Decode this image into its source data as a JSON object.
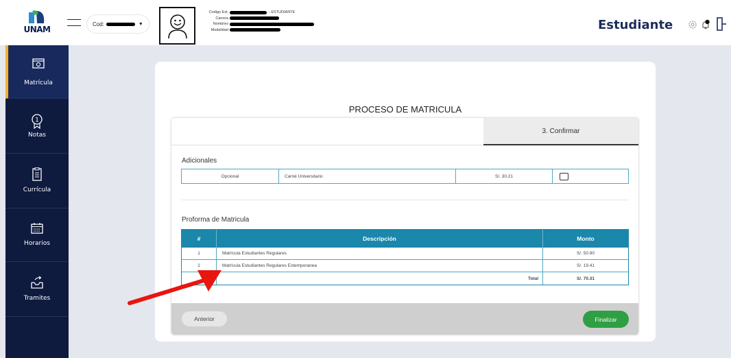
{
  "header": {
    "logo_text": "UNAM",
    "cod_label": "Cod:",
    "student_labels": [
      "Codigo Est.",
      "Carrera",
      "Nombres",
      "Modalidad"
    ],
    "student_role_suffix": "- ESTUDIANTE",
    "role_title": "Estudiante",
    "icons": [
      "settings-icon",
      "notification-bell-icon",
      "logout-icon"
    ]
  },
  "sidebar": {
    "items": [
      {
        "label": "Matrícula",
        "icon": "enrollment-icon",
        "active": true
      },
      {
        "label": "Notas",
        "icon": "grades-icon",
        "active": false
      },
      {
        "label": "Currícula",
        "icon": "curriculum-icon",
        "active": false
      },
      {
        "label": "Horarios",
        "icon": "schedule-icon",
        "active": false
      },
      {
        "label": "Tramites",
        "icon": "procedures-icon",
        "active": false
      }
    ]
  },
  "main": {
    "title": "PROCESO DE MATRICULA",
    "active_step": "3. Confirmar",
    "adicionales": {
      "title": "Adicionales",
      "row": {
        "tipo": "Opcional",
        "descripcion": "Carné Universitario",
        "monto": "S/. 30.21",
        "checked": false
      }
    },
    "proforma": {
      "title": "Proforma de Matricula",
      "headers": [
        "#",
        "Descripción",
        "Monto"
      ],
      "rows": [
        {
          "num": "1",
          "desc": "Matrícula Estudiantes Regulares",
          "monto": "S/. 50.90"
        },
        {
          "num": "2",
          "desc": "Matrícula Estudiantes Regulares Extemporanea",
          "monto": "S/. 19.41"
        }
      ],
      "total_label": "Total",
      "total_value": "S/. 70.31"
    },
    "buttons": {
      "prev": "Anterior",
      "finish": "Finalizar"
    }
  },
  "colors": {
    "sidebar_bg": "#0e1a3e",
    "active_accent": "#f2b02a",
    "table_header": "#1a87ab",
    "finish_button": "#2f9f44",
    "annotation_arrow": "#e8160f"
  }
}
